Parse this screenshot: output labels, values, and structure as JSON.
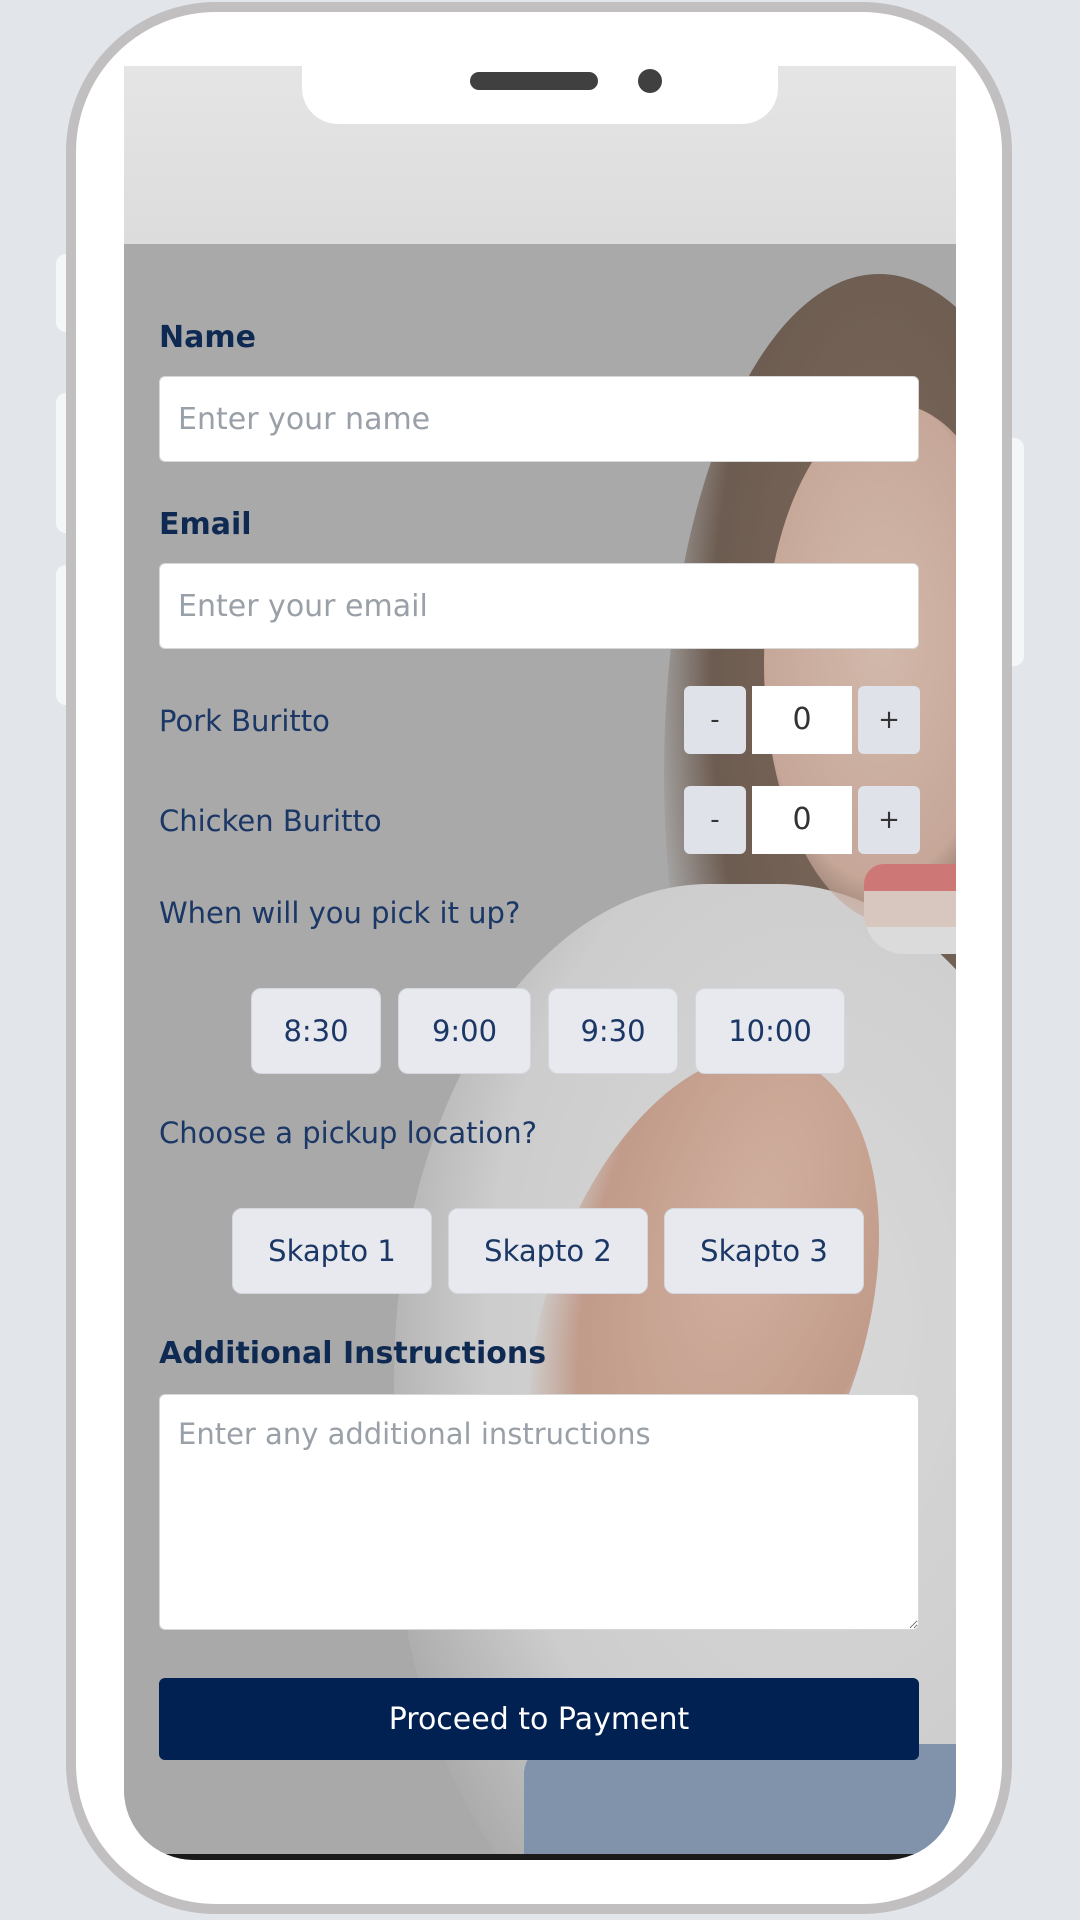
{
  "form": {
    "name_label": "Name",
    "name_placeholder": "Enter your name",
    "email_label": "Email",
    "email_placeholder": "Enter your email",
    "items": [
      {
        "label": "Pork Buritto",
        "quantity": "0",
        "minus": "-",
        "plus": "+"
      },
      {
        "label": "Chicken Buritto",
        "quantity": "0",
        "minus": "-",
        "plus": "+"
      }
    ],
    "pickup_time_label": "When will you pick it up?",
    "pickup_times": [
      "8:30",
      "9:00",
      "9:30",
      "10:00"
    ],
    "pickup_location_label": "Choose a pickup location?",
    "pickup_locations": [
      "Skapto 1",
      "Skapto 2",
      "Skapto 3"
    ],
    "instructions_label": "Additional Instructions",
    "instructions_placeholder": "Enter any additional instructions",
    "submit_label": "Proceed to Payment"
  },
  "colors": {
    "primary": "#002152",
    "label_text": "#0f2a52",
    "chip_bg": "#e7e9ee",
    "frame": "#c2bfc0"
  }
}
